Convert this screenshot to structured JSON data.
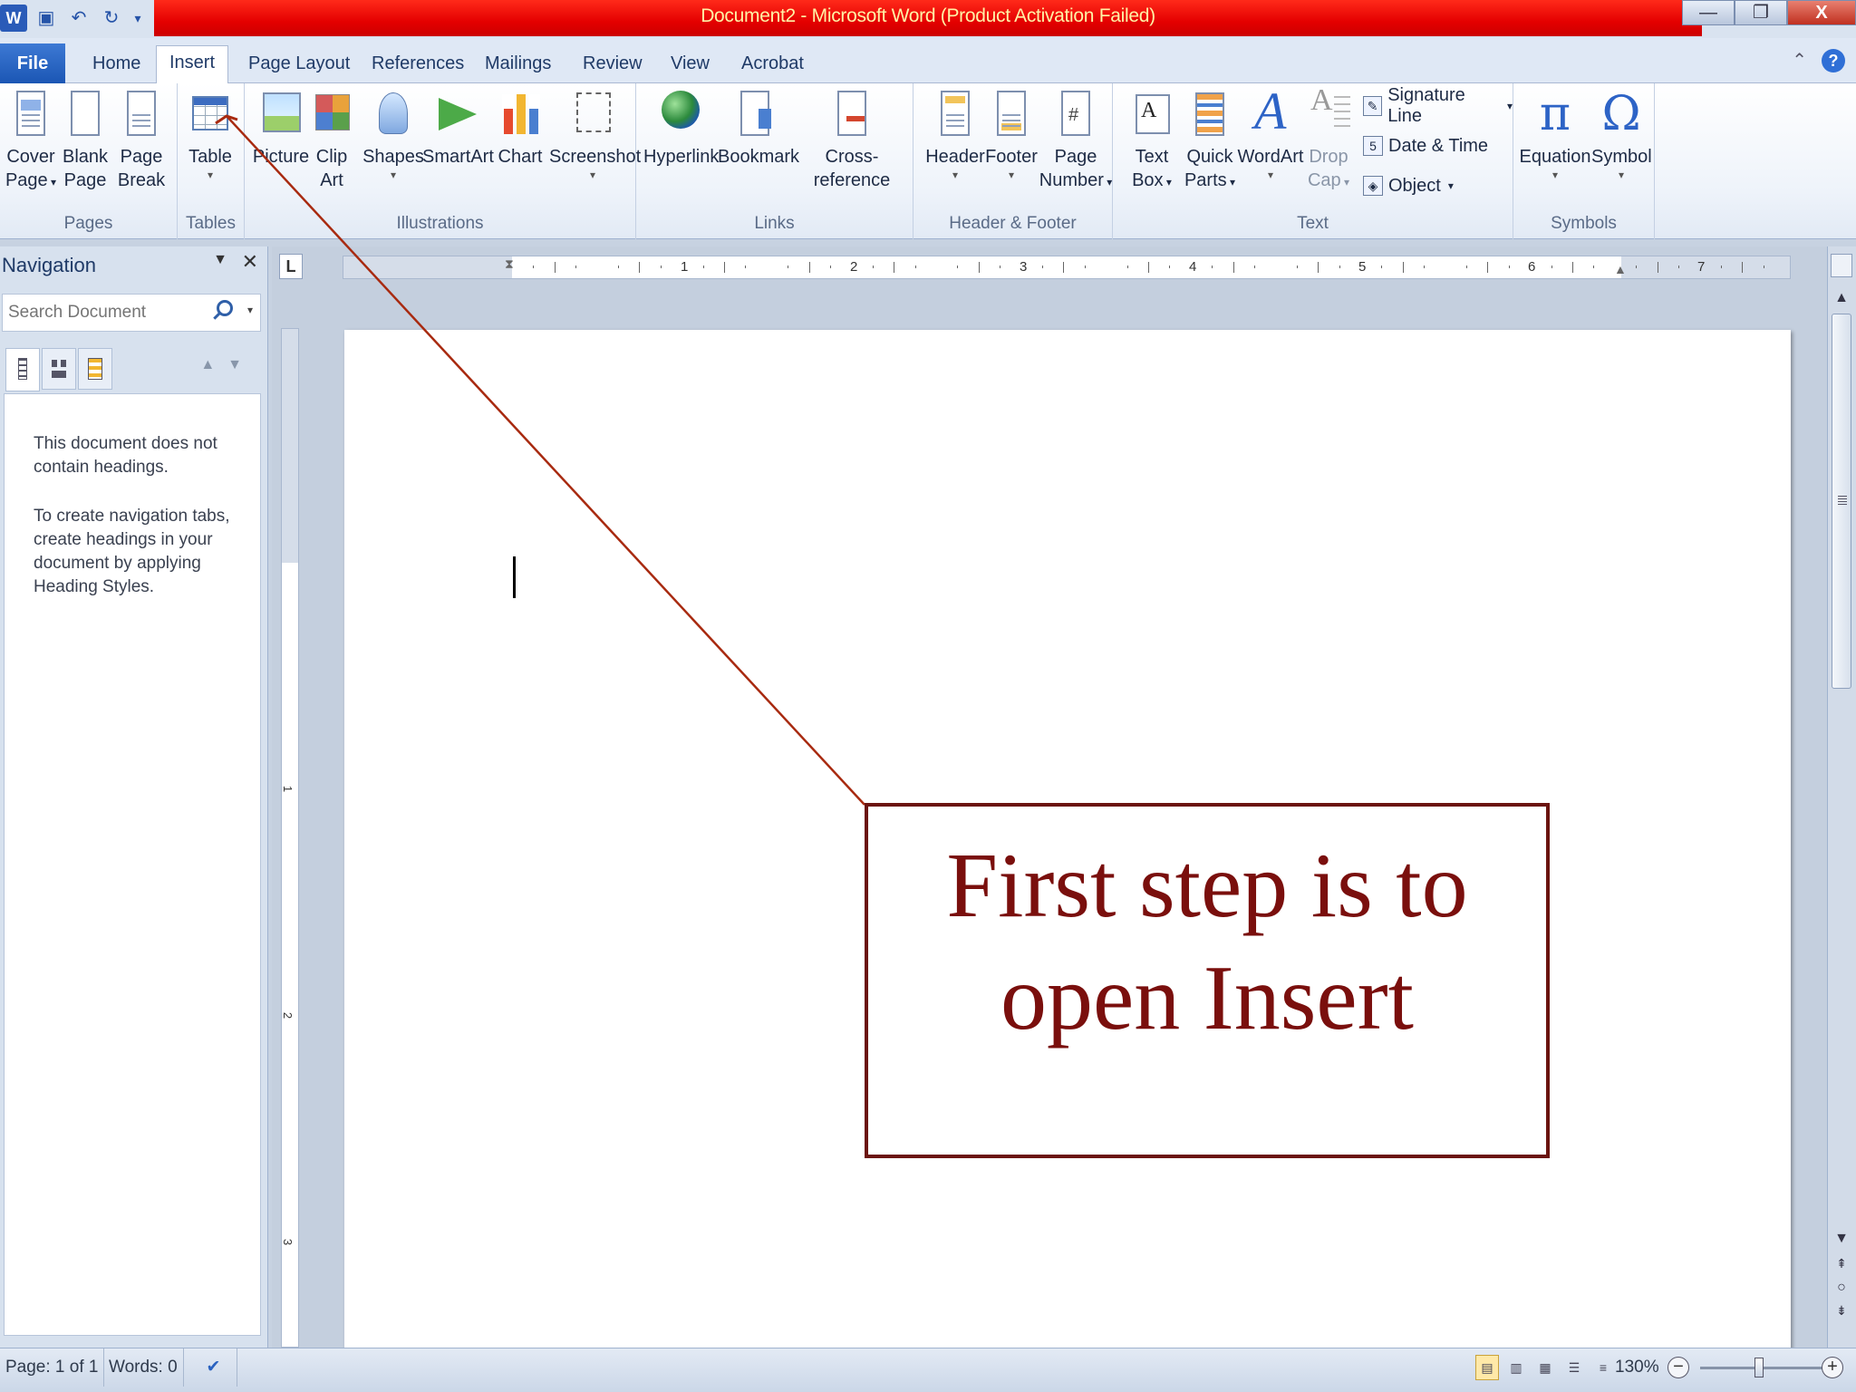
{
  "window": {
    "title": "Document2  -  Microsoft Word (Product Activation Failed)",
    "quick_access": [
      "word-logo",
      "save-icon",
      "undo-icon",
      "redo-icon",
      "customize-icon"
    ],
    "controls": {
      "minimize": "—",
      "restore": "❐",
      "close": "X"
    }
  },
  "tabs": [
    "File",
    "Home",
    "Insert",
    "Page Layout",
    "References",
    "Mailings",
    "Review",
    "View",
    "Acrobat"
  ],
  "active_tab": "Insert",
  "ribbon": {
    "pages": {
      "label": "Pages",
      "cover_page": [
        "Cover",
        "Page"
      ],
      "blank_page": [
        "Blank",
        "Page"
      ],
      "page_break": [
        "Page",
        "Break"
      ]
    },
    "tables": {
      "label": "Tables",
      "table": "Table"
    },
    "illustrations": {
      "label": "Illustrations",
      "picture": "Picture",
      "clip_art": [
        "Clip",
        "Art"
      ],
      "shapes": "Shapes",
      "smartart": "SmartArt",
      "chart": "Chart",
      "screenshot": "Screenshot"
    },
    "links": {
      "label": "Links",
      "hyperlink": "Hyperlink",
      "bookmark": "Bookmark",
      "cross_reference": "Cross-reference"
    },
    "header_footer": {
      "label": "Header & Footer",
      "header": "Header",
      "footer": "Footer",
      "page_number": [
        "Page",
        "Number"
      ]
    },
    "text": {
      "label": "Text",
      "text_box": [
        "Text",
        "Box"
      ],
      "quick_parts": [
        "Quick",
        "Parts"
      ],
      "wordart": "WordArt",
      "drop_cap": [
        "Drop",
        "Cap"
      ],
      "signature_line": "Signature Line",
      "date_time": "Date & Time",
      "object": "Object"
    },
    "symbols": {
      "label": "Symbols",
      "equation": "Equation",
      "symbol": "Symbol"
    }
  },
  "navigation": {
    "title": "Navigation",
    "search_placeholder": "Search Document",
    "message1": "This document does not contain headings.",
    "message2": "To create navigation tabs, create headings in your document by applying Heading Styles."
  },
  "ruler": {
    "numbers": [
      "1",
      "2",
      "3",
      "4",
      "5",
      "6",
      "7"
    ],
    "vertical_numbers": [
      "1",
      "2",
      "3"
    ]
  },
  "status": {
    "page": "Page: 1 of 1",
    "words": "Words: 0",
    "zoom": "130%"
  },
  "annotation": {
    "line1": "First step is to",
    "line2": "open Insert",
    "color": "#7a0f0d"
  },
  "colors": {
    "titlebar": "#e40000",
    "title_text": "#fff2a6",
    "file_tab": "#2a62c0"
  }
}
